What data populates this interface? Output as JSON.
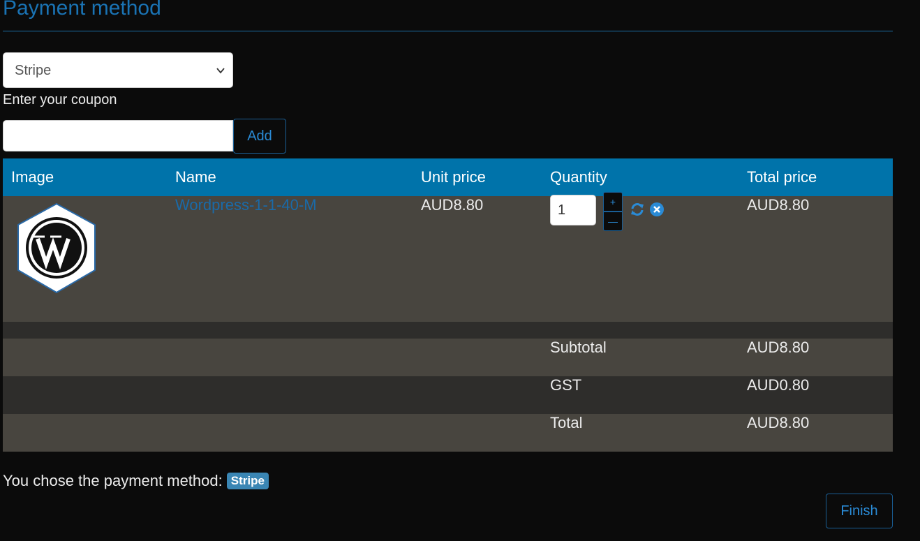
{
  "header": {
    "title": "Payment method"
  },
  "payment": {
    "selected": "Stripe"
  },
  "coupon": {
    "label": "Enter your coupon",
    "value": "",
    "add_label": "Add"
  },
  "table": {
    "headers": {
      "image": "Image",
      "name": "Name",
      "unit_price": "Unit price",
      "quantity": "Quantity",
      "total_price": "Total price"
    },
    "items": [
      {
        "name": "Wordpress-1-1-40-M",
        "unit_price": "AUD8.80",
        "quantity": "1",
        "total_price": "AUD8.80",
        "plus_label": "+",
        "minus_label": "—"
      }
    ],
    "summary": {
      "subtotal_label": "Subtotal",
      "subtotal_value": "AUD8.80",
      "gst_label": "GST",
      "gst_value": "AUD0.80",
      "total_label": "Total",
      "total_value": "AUD8.80"
    }
  },
  "footer": {
    "chosen_text": "You chose the payment method:",
    "chosen_badge": "Stripe",
    "finish_label": "Finish"
  },
  "colors": {
    "accent": "#0073aa",
    "link": "#1a6aa8",
    "row_light": "#48453f",
    "row_dark": "#2e2d2b",
    "badge": "#3a86b4"
  },
  "icons": {
    "select": "chevron-down-icon",
    "refresh": "refresh-icon",
    "remove": "remove-icon",
    "logo": "wordpress-logo"
  }
}
